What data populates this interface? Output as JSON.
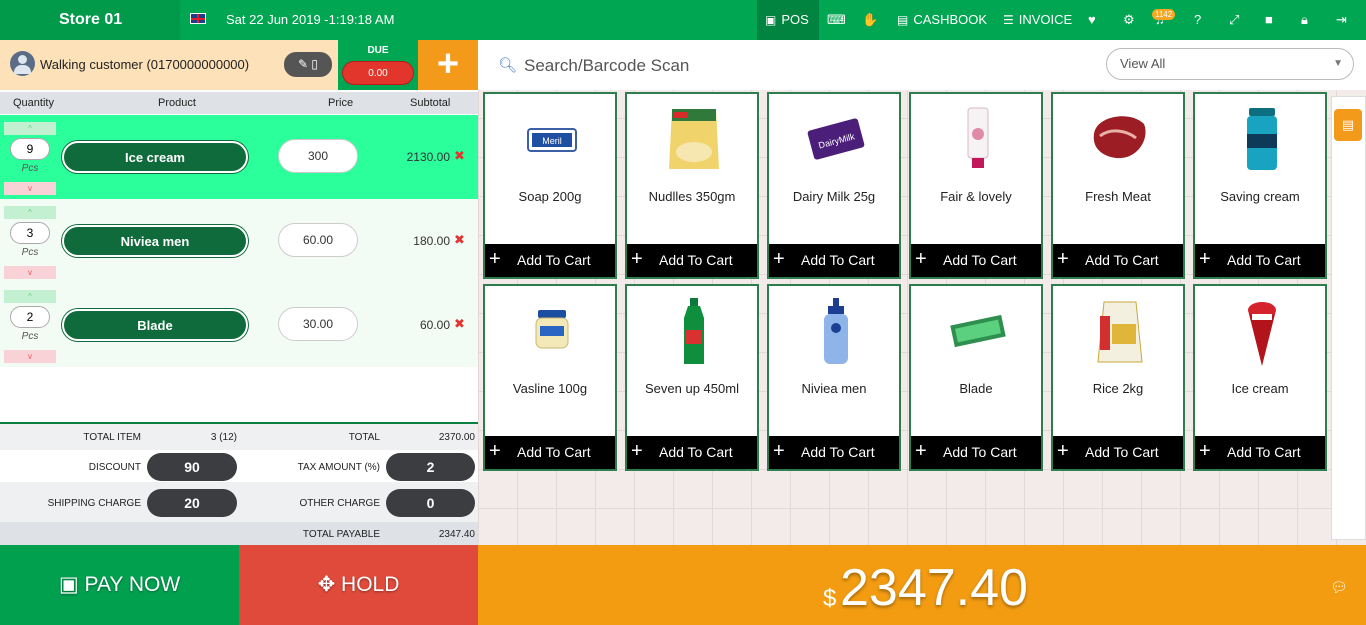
{
  "header": {
    "store": "Store 01",
    "datetime": "Sat 22 Jun 2019 -1:19:18 AM",
    "nav": {
      "pos": "POS",
      "cashbook": "CASHBOOK",
      "invoice": "INVOICE",
      "notifications_count": "1142"
    }
  },
  "customer": {
    "name": "Walking customer (0170000000000)",
    "due_label": "DUE",
    "due_amount": "0.00"
  },
  "cart": {
    "columns": [
      "Quantity",
      "Product",
      "Price",
      "Subtotal"
    ],
    "items": [
      {
        "qty": "9",
        "unit": "Pcs",
        "name": "Ice cream",
        "price": "300",
        "subtotal": "2130.00"
      },
      {
        "qty": "3",
        "unit": "Pcs",
        "name": "Niviea men",
        "price": "60.00",
        "subtotal": "180.00"
      },
      {
        "qty": "2",
        "unit": "Pcs",
        "name": "Blade",
        "price": "30.00",
        "subtotal": "60.00"
      }
    ]
  },
  "totals": {
    "total_item_label": "TOTAL ITEM",
    "total_item": "3 (12)",
    "total_label": "TOTAL",
    "total": "2370.00",
    "discount_label": "DISCOUNT",
    "discount": "90",
    "tax_label": "TAX AMOUNT (%)",
    "tax": "2",
    "shipping_label": "SHIPPING CHARGE",
    "shipping": "20",
    "other_label": "OTHER CHARGE",
    "other": "0",
    "payable_label": "TOTAL PAYABLE",
    "payable": "2347.40"
  },
  "actions": {
    "pay_now": "PAY NOW",
    "hold": "HOLD",
    "currency": "$",
    "grand_total": "2347.40"
  },
  "search": {
    "placeholder": "Search/Barcode Scan",
    "filter": "View All"
  },
  "products": [
    {
      "name": "Soap 200g",
      "icon": "soap-icon",
      "add_label": "Add To Cart"
    },
    {
      "name": "Nudlles 350gm",
      "icon": "noodles-icon",
      "add_label": "Add To Cart"
    },
    {
      "name": "Dairy Milk 25g",
      "icon": "chocolate-icon",
      "add_label": "Add To Cart"
    },
    {
      "name": "Fair & lovely",
      "icon": "cream-tube-icon",
      "add_label": "Add To Cart"
    },
    {
      "name": "Fresh Meat",
      "icon": "meat-icon",
      "add_label": "Add To Cart"
    },
    {
      "name": "Saving cream",
      "icon": "shaving-cream-icon",
      "add_label": "Add To Cart"
    },
    {
      "name": "Vasline 100g",
      "icon": "jar-icon",
      "add_label": "Add To Cart"
    },
    {
      "name": "Seven up 450ml",
      "icon": "bottle-icon",
      "add_label": "Add To Cart"
    },
    {
      "name": "Niviea men",
      "icon": "lotion-icon",
      "add_label": "Add To Cart"
    },
    {
      "name": "Blade",
      "icon": "blade-icon",
      "add_label": "Add To Cart"
    },
    {
      "name": "Rice 2kg",
      "icon": "rice-bag-icon",
      "add_label": "Add To Cart"
    },
    {
      "name": "Ice cream",
      "icon": "ice-cream-cone-icon",
      "add_label": "Add To Cart"
    }
  ],
  "colors": {
    "brand_green": "#00a651",
    "orange": "#f39c12",
    "red": "#e04a3b",
    "dark_green_pill": "#0f6b3b"
  }
}
